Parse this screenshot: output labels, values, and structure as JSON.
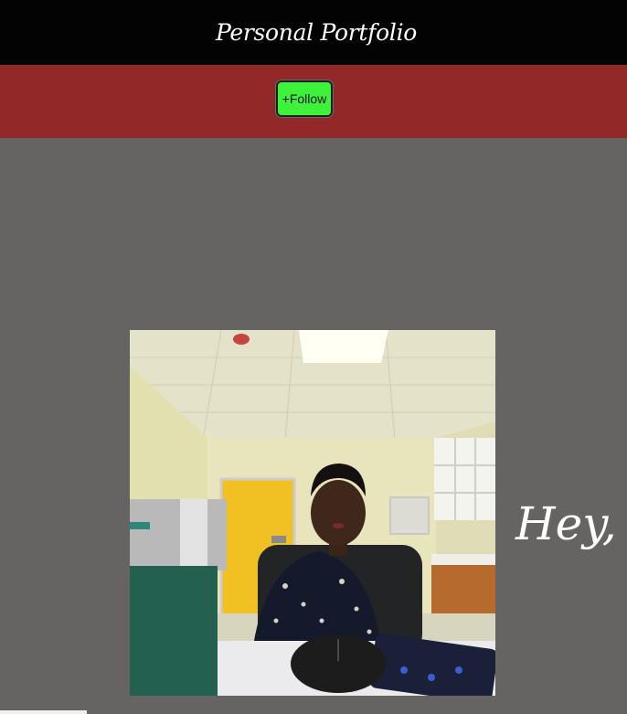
{
  "header": {
    "title": "Personal Portfolio"
  },
  "follow_bar": {
    "follow_label": "+Follow"
  },
  "hero": {
    "greeting": "Hey, I"
  },
  "colors": {
    "header_bg": "#040304",
    "follow_bar_bg": "#922828",
    "follow_button_bg": "#3ef13a",
    "page_bg": "#656463"
  }
}
